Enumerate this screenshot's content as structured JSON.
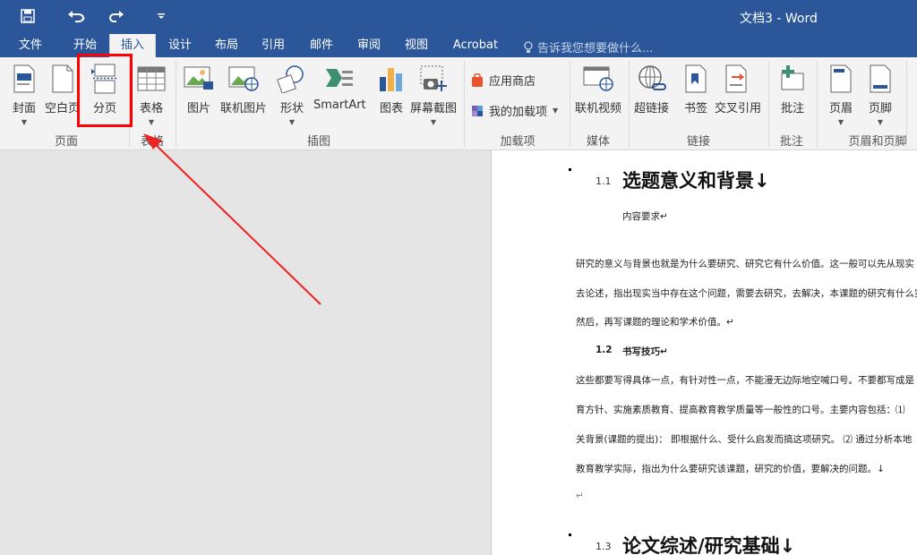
{
  "app": {
    "title": "文档3 - Word"
  },
  "quick_access": {
    "save": "save-icon",
    "undo": "undo-icon",
    "redo": "redo-icon",
    "customize": "customize-icon"
  },
  "tabs": [
    {
      "label": "文件"
    },
    {
      "label": "开始"
    },
    {
      "label": "插入"
    },
    {
      "label": "设计"
    },
    {
      "label": "布局"
    },
    {
      "label": "引用"
    },
    {
      "label": "邮件"
    },
    {
      "label": "审阅"
    },
    {
      "label": "视图"
    },
    {
      "label": "Acrobat"
    }
  ],
  "active_tab": "插入",
  "tell_me": {
    "placeholder": "告诉我您想要做什么..."
  },
  "ribbon": {
    "pages": {
      "cover": "封面",
      "blank": "空白页",
      "break": "分页",
      "group": "页面"
    },
    "tables": {
      "table": "表格",
      "group": "表格"
    },
    "illustrations": {
      "picture": "图片",
      "online_picture": "联机图片",
      "shapes": "形状",
      "smartart": "SmartArt",
      "chart": "图表",
      "screenshot": "屏幕截图",
      "group": "插图"
    },
    "addins": {
      "store": "应用商店",
      "my_addins": "我的加载项",
      "group": "加载项"
    },
    "media": {
      "online_video": "联机视频",
      "group": "媒体"
    },
    "links": {
      "hyperlink": "超链接",
      "bookmark": "书签",
      "cross_ref": "交叉引用",
      "group": "链接"
    },
    "comments": {
      "comment": "批注",
      "group": "批注"
    },
    "header_footer": {
      "header": "页眉",
      "footer": "页脚",
      "group": "页眉和页脚"
    }
  },
  "document": {
    "h1a_num": "1.1",
    "h1a": "选题意义和背景↓",
    "content_req": "内容要求↵",
    "p1": "研究的意义与背景也就是为什么要研究、研究它有什么价值。这一般可以先从现实",
    "p2": "去论述，指出现实当中存在这个问题，需要去研究，去解决，本课题的研究有什么实",
    "p3": "然后，再写课题的理论和学术价值。↵",
    "h2_num": "1.2",
    "h2": "书写技巧↵",
    "p4": "这些都要写得具体一点，有针对性一点，不能漫无边际地空喊口号。不要都写成是",
    "p5": "育方针、实施素质教育、提高教育教学质量等一般性的口号。主要内容包括：⑴",
    "p6": "关背景(课题的提出)：  即根据什么、受什么启发而搞这项研究。 ⑵  通过分析本地",
    "p7": "教育教学实际，指出为什么要研究该课题，研究的价值，要解决的问题。↓",
    "p8": "↵",
    "h1b_num": "1.3",
    "h1b": "论文综述/研究基础↓"
  },
  "colors": {
    "titlebar": "#2b579a",
    "highlight": "#ff0000"
  }
}
